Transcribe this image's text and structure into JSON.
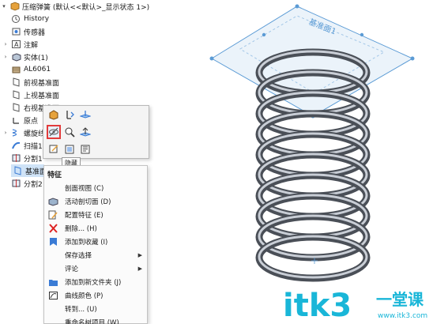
{
  "tree": {
    "root_label": "压缩弹簧 (默认<<默认>_显示状态 1>)",
    "items": [
      {
        "label": "History"
      },
      {
        "label": "传感器"
      },
      {
        "label": "注解"
      },
      {
        "label": "实体(1)"
      },
      {
        "label": "AL6061"
      },
      {
        "label": "前视基准面"
      },
      {
        "label": "上视基准面"
      },
      {
        "label": "右视基准面"
      },
      {
        "label": "原点"
      },
      {
        "label": "螺旋线"
      },
      {
        "label": "扫描1"
      },
      {
        "label": "分割1"
      },
      {
        "label": "基准面"
      },
      {
        "label": "分割2"
      }
    ]
  },
  "toolbar": {
    "tooltip": "隐藏"
  },
  "menu": {
    "title": "特征",
    "items": [
      {
        "label": "剖面视图 (C)"
      },
      {
        "label": "活动剖切面 (D)"
      },
      {
        "label": "配置特征 (E)"
      },
      {
        "label": "删除... (H)"
      },
      {
        "label": "添加到收藏 (I)"
      },
      {
        "label": "保存选择"
      },
      {
        "label": "评论"
      },
      {
        "label": "添加到新文件夹 (J)"
      },
      {
        "label": "曲线颜色 (P)"
      },
      {
        "label": "转到... (U)"
      },
      {
        "label": "重命名树项目 (W)"
      }
    ]
  },
  "viewport": {
    "plane_label": "基准面1"
  },
  "watermark": {
    "brand": "itk3",
    "tagline": "一堂课",
    "url": "www.itk3.com"
  },
  "colors": {
    "selection": "#cfe3f7",
    "plane": "#5b9bd5",
    "highlight": "#e23b3b",
    "spring_dark": "#4a4f57",
    "spring_light": "#c9ced6",
    "watermark": "#19b6d8"
  }
}
